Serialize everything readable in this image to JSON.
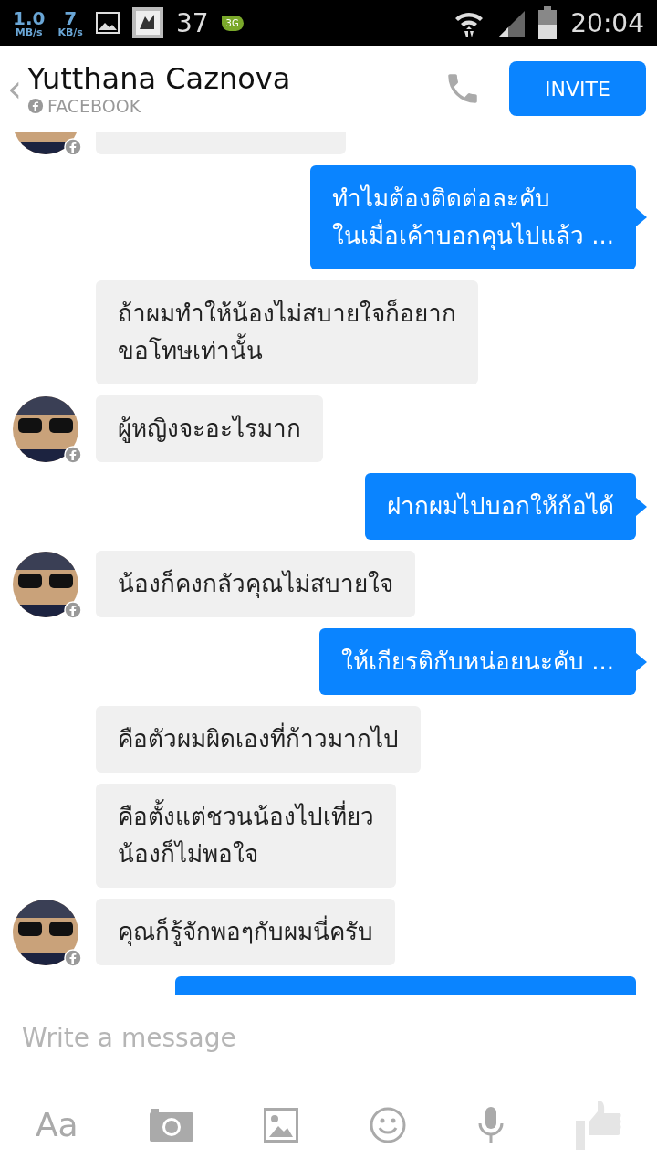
{
  "status_bar": {
    "download_rate": "1.0",
    "download_unit": "MB/s",
    "upload_rate": "7",
    "upload_unit": "KB/s",
    "notification_count": "37",
    "network_type": "3G",
    "time": "20:04"
  },
  "header": {
    "back": "‹",
    "name": "Yutthana Caznova",
    "source": "FACEBOOK",
    "invite_button": "INVITE"
  },
  "messages": [
    {
      "kind": "incoming",
      "cut": true,
      "avatar": true
    },
    {
      "kind": "outgoing",
      "cut": false,
      "text": "ทำไมต้องติดต่อละคับ\nในเมื่อเค้าบอกคุนไปแล้ว ..."
    },
    {
      "kind": "incoming",
      "cut": false,
      "avatar": false,
      "text": "ถ้าผมทำให้น้องไม่สบายใจก็อยาก\nขอโทษเท่านั้น"
    },
    {
      "kind": "incoming",
      "cut": false,
      "avatar": true,
      "text": "ผู้หญิงจะอะไรมาก"
    },
    {
      "kind": "outgoing",
      "cut": false,
      "text": "ฝากผมไปบอกให้ก้อได้"
    },
    {
      "kind": "incoming",
      "cut": false,
      "avatar": true,
      "text": "น้องก็คงกลัวคุณไม่สบายใจ"
    },
    {
      "kind": "outgoing",
      "cut": false,
      "text": "ให้เกียรติกับหน่อยนะคับ ..."
    },
    {
      "kind": "incoming",
      "cut": false,
      "avatar": false,
      "text": "คือตัวผมผิดเองที่ก้าวมากไป"
    },
    {
      "kind": "incoming",
      "cut": false,
      "avatar": false,
      "text": "คือตั้งแต่ชวนน้องไปเที่ยว\nน้องก็ไม่พอใจ"
    },
    {
      "kind": "incoming",
      "cut": false,
      "avatar": true,
      "text": "คุณก็รู้จักพอๆกับผมนี่ครับ"
    },
    {
      "kind": "outgoing",
      "cut": true
    }
  ],
  "composer": {
    "placeholder": "Write a message",
    "text_button": "Aa"
  }
}
